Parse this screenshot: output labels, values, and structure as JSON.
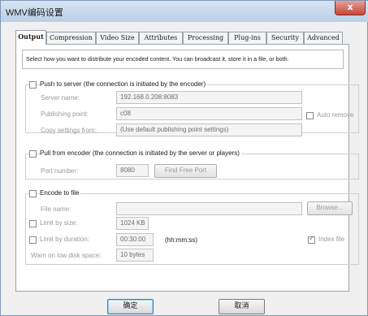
{
  "window": {
    "title": "WMV编码设置",
    "close_glyph": "x"
  },
  "tabs": [
    {
      "label": "Output",
      "active": true
    },
    {
      "label": "Compression"
    },
    {
      "label": "Video Size"
    },
    {
      "label": "Attributes"
    },
    {
      "label": "Processing"
    },
    {
      "label": "Plug-ins"
    },
    {
      "label": "Security"
    },
    {
      "label": "Advanced"
    }
  ],
  "output": {
    "description": "Select how you want to distribute your encoded content. You can broadcast it, store it in a file, or both.",
    "push": {
      "label": "Push to server (the connection is initiated by the encoder)",
      "checked": false,
      "server_name_label": "Server name:",
      "server_name_value": "192.168.0.208:8083",
      "publishing_point_label": "Publishing point:",
      "publishing_point_value": "c08",
      "copy_settings_label": "Copy settings from:",
      "copy_settings_value": "(Use default publishing point settings)",
      "auto_remove_label": "Auto remove",
      "auto_remove_checked": false
    },
    "pull": {
      "label": "Pull from encoder (the connection is initiated by the server or players)",
      "checked": false,
      "port_label": "Port number:",
      "port_value": "8080",
      "find_port_button": "Find Free Port"
    },
    "file": {
      "label": "Encode to file",
      "checked": false,
      "file_name_label": "File name:",
      "file_name_value": "",
      "browse_button": "Browse...",
      "limit_size_label": "Limit by size:",
      "limit_size_checked": false,
      "limit_size_value": "1024 KB",
      "limit_duration_label": "Limit by duration:",
      "limit_duration_checked": false,
      "limit_duration_value": "00:30:00",
      "duration_format": "(hh:mm:ss)",
      "index_file_label": "Index file",
      "index_file_checked": true,
      "warn_low_disk_label": "Warn on low disk space:",
      "warn_low_disk_value": "10 bytes"
    }
  },
  "buttons": {
    "ok": "确定",
    "cancel": "取消"
  }
}
